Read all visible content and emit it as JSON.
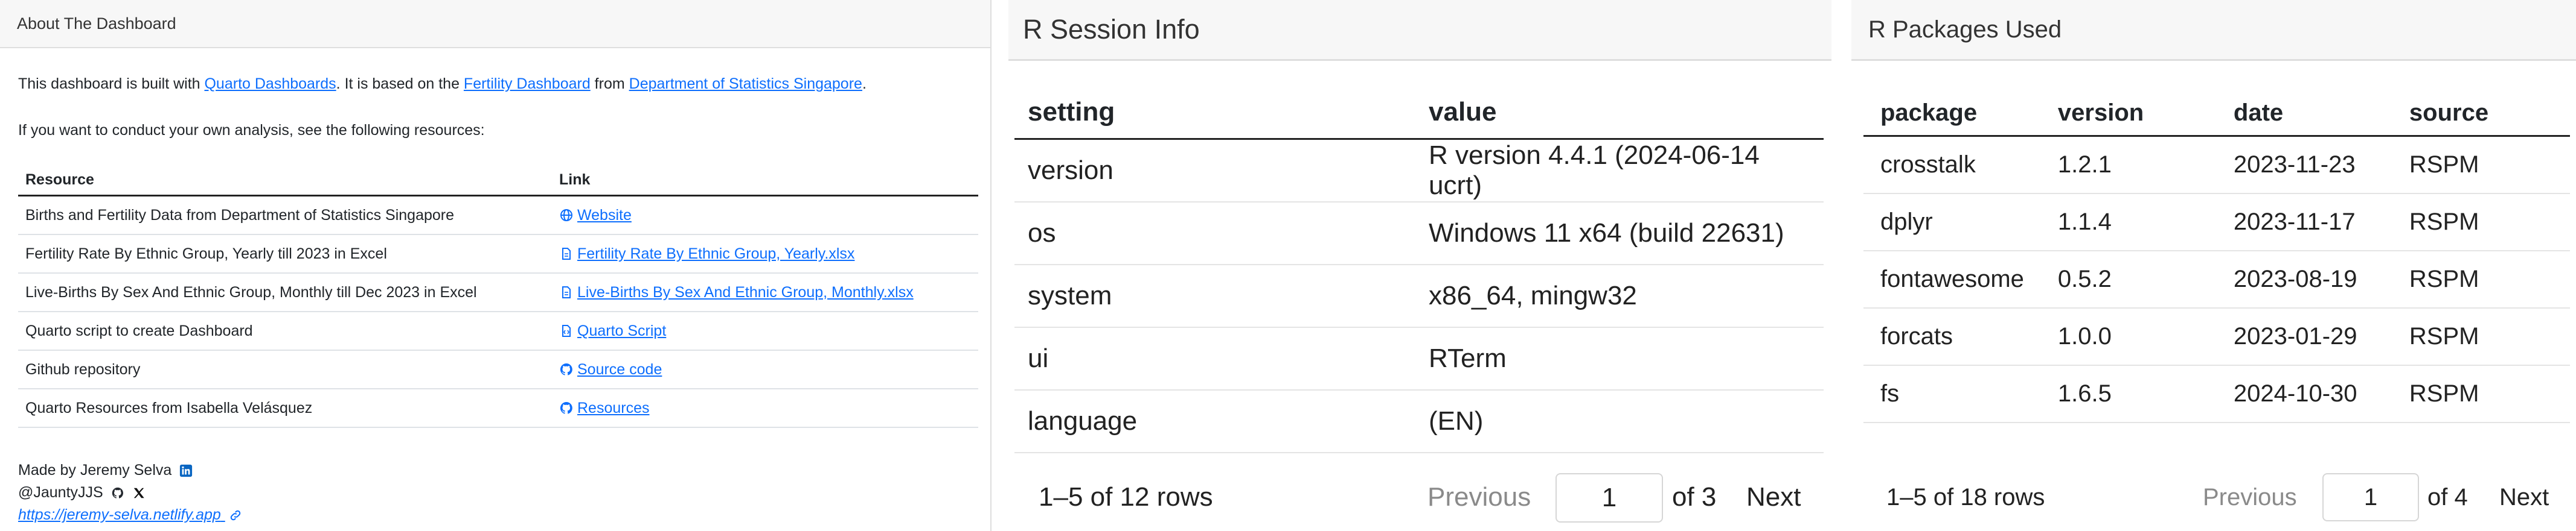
{
  "about": {
    "header": "About The Dashboard",
    "intro": {
      "prefix": "This dashboard is built with ",
      "link1": "Quarto Dashboards",
      "middle1": ". It is based on the ",
      "link2": "Fertility Dashboard",
      "middle2": " from ",
      "link3": "Department of Statistics Singapore",
      "suffix": "."
    },
    "second_para": "If you want to conduct your own analysis, see the following resources:",
    "table": {
      "headers": [
        "Resource",
        "Link"
      ],
      "rows": [
        {
          "resource": "Births and Fertility Data from Department of Statistics Singapore",
          "link": "Website",
          "icon": "globe-icon"
        },
        {
          "resource": "Fertility Rate By Ethnic Group, Yearly till 2023 in Excel",
          "link": "Fertility Rate By Ethnic Group, Yearly.xlsx",
          "icon": "file-icon"
        },
        {
          "resource": "Live-Births By Sex And Ethnic Group, Monthly till Dec 2023 in Excel",
          "link": "Live-Births By Sex And Ethnic Group, Monthly.xlsx",
          "icon": "file-icon"
        },
        {
          "resource": "Quarto script to create Dashboard",
          "link": "Quarto Script",
          "icon": "code-file-icon"
        },
        {
          "resource": "Github repository",
          "link": "Source code",
          "icon": "github-icon"
        },
        {
          "resource": "Quarto Resources from Isabella Velásquez",
          "link": "Resources",
          "icon": "github-icon"
        }
      ]
    },
    "footer": {
      "made_by": "Made by Jeremy Selva",
      "handle": "@JauntyJJS",
      "website": "https://jeremy-selva.netlify.app"
    }
  },
  "session": {
    "header": "R Session Info",
    "columns": [
      "setting",
      "value"
    ],
    "rows": [
      {
        "setting": "version",
        "value": "R version 4.4.1 (2024-06-14 ucrt)"
      },
      {
        "setting": "os",
        "value": "Windows 11 x64 (build 22631)"
      },
      {
        "setting": "system",
        "value": "x86_64, mingw32"
      },
      {
        "setting": "ui",
        "value": "RTerm"
      },
      {
        "setting": "language",
        "value": "(EN)"
      }
    ],
    "pagination": {
      "range": "1–5 of 12 rows",
      "previous": "Previous",
      "page": "1",
      "of": "of 3",
      "next": "Next"
    }
  },
  "packages": {
    "header": "R Packages Used",
    "columns": [
      "package",
      "version",
      "date",
      "source"
    ],
    "rows": [
      {
        "package": "crosstalk",
        "version": "1.2.1",
        "date": "2023-11-23",
        "source": "RSPM"
      },
      {
        "package": "dplyr",
        "version": "1.1.4",
        "date": "2023-11-17",
        "source": "RSPM"
      },
      {
        "package": "fontawesome",
        "version": "0.5.2",
        "date": "2023-08-19",
        "source": "RSPM"
      },
      {
        "package": "forcats",
        "version": "1.0.0",
        "date": "2023-01-29",
        "source": "RSPM"
      },
      {
        "package": "fs",
        "version": "1.6.5",
        "date": "2024-10-30",
        "source": "RSPM"
      }
    ],
    "pagination": {
      "range": "1–5 of 18 rows",
      "previous": "Previous",
      "page": "1",
      "of": "of 4",
      "next": "Next"
    }
  },
  "colors": {
    "link": "#0d6efd",
    "header_bg": "#f7f7f7",
    "linkedin": "#0a66c2",
    "muted": "#8a8a8a"
  }
}
